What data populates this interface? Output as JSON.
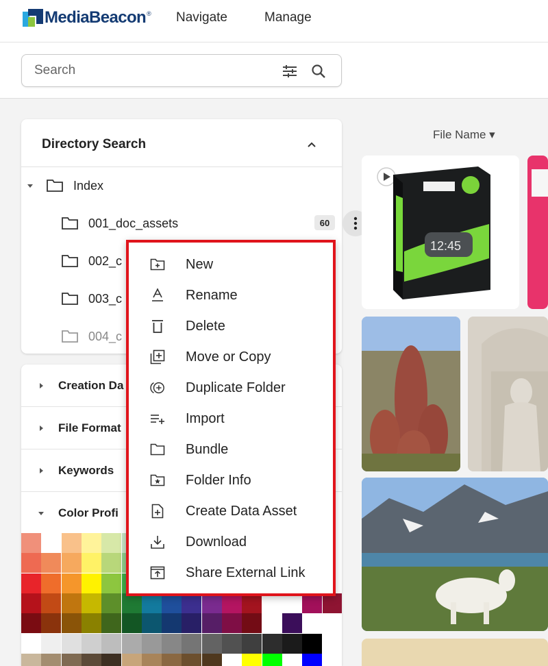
{
  "header": {
    "logo_text": "MediaBeacon",
    "logo_reg": "®",
    "nav": [
      {
        "label": "Navigate"
      },
      {
        "label": "Manage"
      }
    ]
  },
  "search": {
    "placeholder": "Search",
    "value": ""
  },
  "directory": {
    "title": "Directory Search",
    "root": "Index",
    "folders": [
      {
        "label": "001_doc_assets",
        "count": "60"
      },
      {
        "label": "002_c"
      },
      {
        "label": "003_c"
      },
      {
        "label": "004_c"
      }
    ]
  },
  "facets": [
    {
      "label": "Creation Da"
    },
    {
      "label": "File Format"
    },
    {
      "label": "Keywords"
    },
    {
      "label": "Color Profi"
    }
  ],
  "main": {
    "sort_label": "File Name ▾"
  },
  "context_menu": {
    "items": [
      {
        "label": "New",
        "icon": "folder-plus-icon"
      },
      {
        "label": "Rename",
        "icon": "rename-icon"
      },
      {
        "label": "Delete",
        "icon": "trash-icon"
      },
      {
        "label": "Move or Copy",
        "icon": "move-copy-icon"
      },
      {
        "label": "Duplicate Folder",
        "icon": "duplicate-icon"
      },
      {
        "label": "Import",
        "icon": "import-icon"
      },
      {
        "label": "Bundle",
        "icon": "bundle-folder-icon"
      },
      {
        "label": "Folder Info",
        "icon": "folder-info-icon"
      },
      {
        "label": "Create Data Asset",
        "icon": "create-data-asset-icon"
      },
      {
        "label": "Download",
        "icon": "download-icon"
      },
      {
        "label": "Share External Link",
        "icon": "share-link-icon"
      }
    ],
    "highlight_color": "#e0141b"
  },
  "colors": {
    "brand_blue": "#143b73",
    "brand_green": "#8dc63f",
    "highlight_red": "#e0141b"
  }
}
